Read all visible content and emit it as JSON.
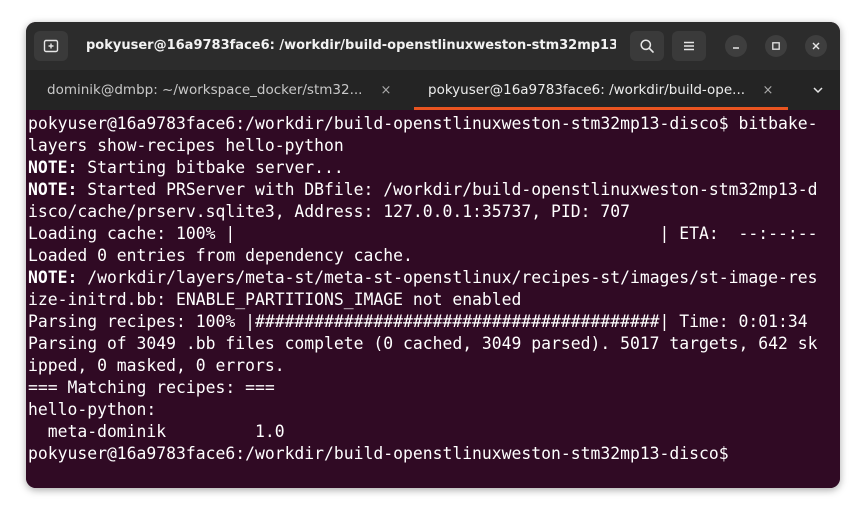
{
  "window": {
    "title": "pokyuser@16a9783face6: /workdir/build-openstlinuxweston-stm32mp13-...",
    "controls": {
      "new_tab_icon": "new-tab-icon",
      "search_icon": "search-icon",
      "menu_icon": "hamburger-menu-icon",
      "minimize_icon": "minimize-icon",
      "maximize_icon": "maximize-icon",
      "close_icon": "close-icon"
    }
  },
  "tabs": [
    {
      "label": "dominik@dmbp: ~/workspace_docker/stm32...",
      "close": "×",
      "active": false
    },
    {
      "label": "pokyuser@16a9783face6: /workdir/build-ope...",
      "close": "×",
      "active": true
    }
  ],
  "tabs_dropdown_icon": "chevron-down-icon",
  "colors": {
    "terminal_bg": "#300a24",
    "terminal_fg": "#ffffff",
    "titlebar_bg": "#2c2c2c",
    "tabbar_bg": "#242424",
    "active_tab_accent": "#e95420"
  },
  "terminal": {
    "lines": [
      {
        "prefix": "",
        "text": "pokyuser@16a9783face6:/workdir/build-openstlinuxweston-stm32mp13-disco$ bitbake-"
      },
      {
        "prefix": "",
        "text": "layers show-recipes hello-python"
      },
      {
        "prefix": "NOTE:",
        "text": " Starting bitbake server..."
      },
      {
        "prefix": "NOTE:",
        "text": " Started PRServer with DBfile: /workdir/build-openstlinuxweston-stm32mp13-d"
      },
      {
        "prefix": "",
        "text": "isco/cache/prserv.sqlite3, Address: 127.0.0.1:35737, PID: 707"
      },
      {
        "prefix": "",
        "text": "Loading cache: 100% |                                           | ETA:  --:--:--"
      },
      {
        "prefix": "",
        "text": "Loaded 0 entries from dependency cache."
      },
      {
        "prefix": "NOTE:",
        "text": " /workdir/layers/meta-st/meta-st-openstlinux/recipes-st/images/st-image-res"
      },
      {
        "prefix": "",
        "text": "ize-initrd.bb: ENABLE_PARTITIONS_IMAGE not enabled"
      },
      {
        "prefix": "",
        "text": "Parsing recipes: 100% |#########################################| Time: 0:01:34"
      },
      {
        "prefix": "",
        "text": "Parsing of 3049 .bb files complete (0 cached, 3049 parsed). 5017 targets, 642 sk"
      },
      {
        "prefix": "",
        "text": "ipped, 0 masked, 0 errors."
      },
      {
        "prefix": "",
        "text": "=== Matching recipes: ==="
      },
      {
        "prefix": "",
        "text": "hello-python:"
      },
      {
        "prefix": "",
        "text": "  meta-dominik         1.0"
      },
      {
        "prefix": "",
        "text": "pokyuser@16a9783face6:/workdir/build-openstlinuxweston-stm32mp13-disco$"
      }
    ]
  }
}
